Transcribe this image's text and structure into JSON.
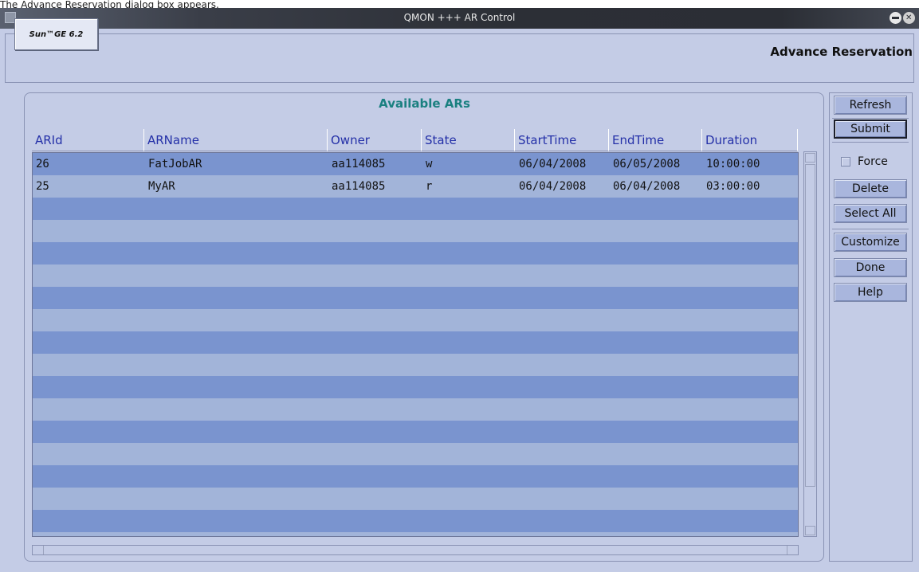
{
  "caption": "The Advance Reservation dialog box appears.",
  "window": {
    "title": "QMON +++ AR Control"
  },
  "header": {
    "logo": "Sun™GE 6.2",
    "title": "Advance Reservation"
  },
  "panel": {
    "title": "Available ARs"
  },
  "table": {
    "columns": [
      "ARId",
      "ARName",
      "Owner",
      "State",
      "StartTime",
      "EndTime",
      "Duration"
    ],
    "rows": [
      [
        "26",
        "FatJobAR",
        "aa114085",
        "w",
        "06/04/2008",
        "06/05/2008",
        "10:00:00"
      ],
      [
        "25",
        "MyAR",
        "aa114085",
        "r",
        "06/04/2008",
        "06/04/2008",
        "03:00:00"
      ]
    ]
  },
  "buttons": {
    "refresh": "Refresh",
    "submit": "Submit",
    "force": "Force",
    "delete": "Delete",
    "select_all": "Select All",
    "customize": "Customize",
    "done": "Done",
    "help": "Help"
  },
  "colors": {
    "row_dark": "#7a94cf",
    "row_light": "#a2b4d9",
    "header_text": "#2430a8",
    "panel_title": "#1a8080"
  }
}
